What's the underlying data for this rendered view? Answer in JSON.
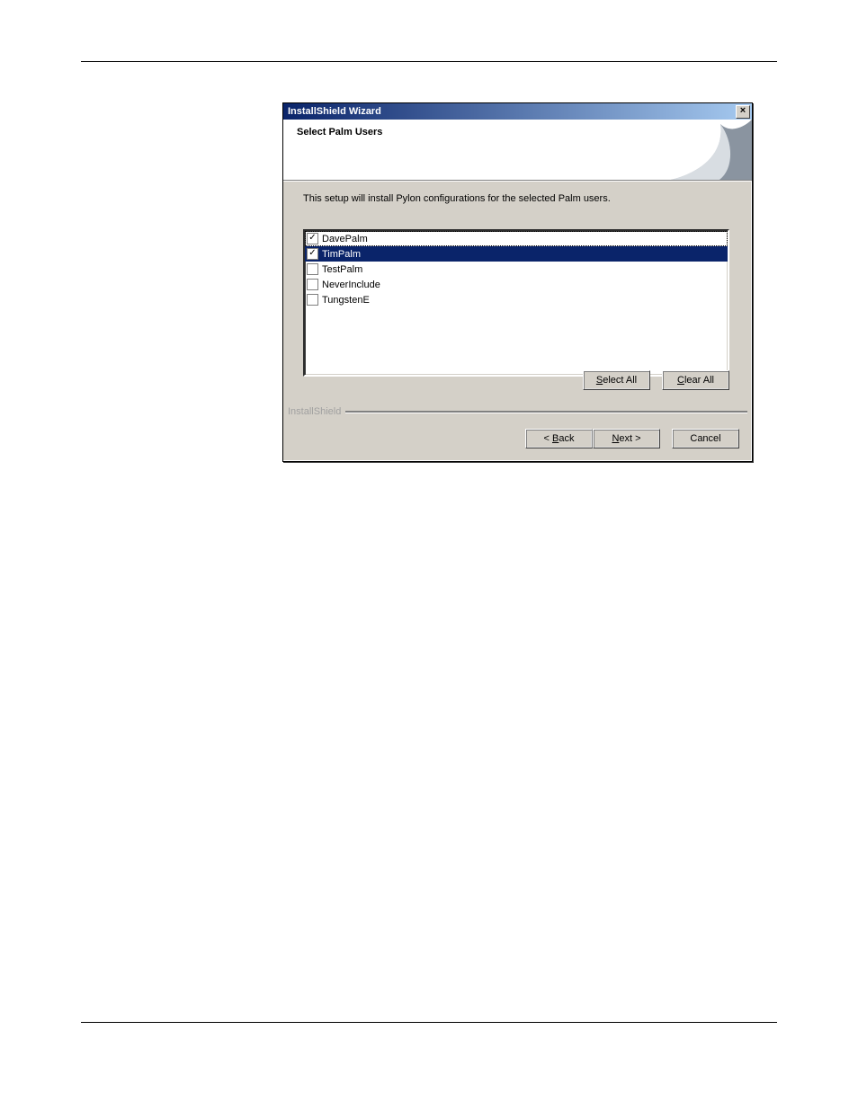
{
  "window": {
    "title": "InstallShield Wizard",
    "close": "×"
  },
  "header": {
    "title": "Select Palm Users"
  },
  "description": "This setup will install Pylon configurations for the selected Palm users.",
  "users": [
    {
      "label": "DavePalm",
      "checked": true,
      "selected": false,
      "focused": true
    },
    {
      "label": "TimPalm",
      "checked": true,
      "selected": true,
      "focused": false
    },
    {
      "label": "TestPalm",
      "checked": false,
      "selected": false,
      "focused": false
    },
    {
      "label": "NeverInclude",
      "checked": false,
      "selected": false,
      "focused": false
    },
    {
      "label": "TungstenE",
      "checked": false,
      "selected": false,
      "focused": false
    }
  ],
  "buttons": {
    "select_all_pre": "",
    "select_all_u": "S",
    "select_all_post": "elect All",
    "clear_all_pre": "",
    "clear_all_u": "C",
    "clear_all_post": "lear All",
    "back_pre": "< ",
    "back_u": "B",
    "back_post": "ack",
    "next_pre": "",
    "next_u": "N",
    "next_post": "ext >",
    "cancel": "Cancel"
  },
  "brand": "InstallShield"
}
